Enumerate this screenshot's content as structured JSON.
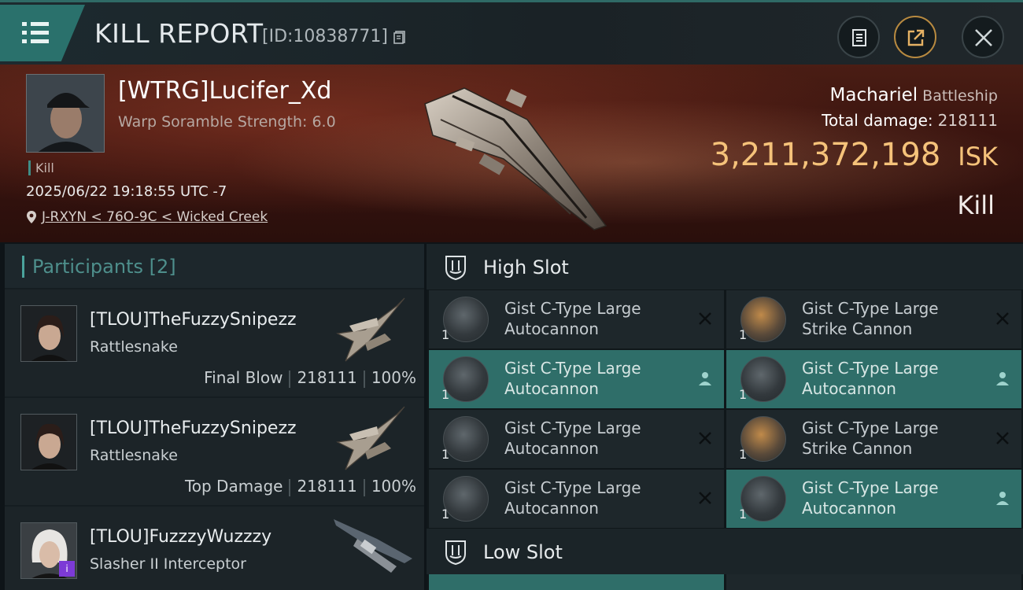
{
  "header": {
    "title": "KILL REPORT",
    "report_id": "[ID:10838771]"
  },
  "victim": {
    "name": "[WTRG]Lucifer_Xd",
    "scramble": "Warp Soramble Strength: 6.0",
    "tag": "Kill",
    "datetime": "2025/06/22 19:18:55 UTC -7",
    "location": "J-RXYN < 76O-9C < Wicked Creek",
    "ship": "Machariel",
    "ship_class": "Battleship",
    "total_damage_label": "Total damage:",
    "total_damage": "218111",
    "isk_value": "3,211,372,198",
    "isk_unit": "ISK",
    "result": "Kill"
  },
  "participants": {
    "label": "Participants",
    "count": "[2]",
    "rows": [
      {
        "name": "[TLOU]TheFuzzySnipezz",
        "ship": "Rattlesnake",
        "role": "Final Blow",
        "damage": "218111",
        "percent": "100%"
      },
      {
        "name": "[TLOU]TheFuzzySnipezz",
        "ship": "Rattlesnake",
        "role": "Top Damage",
        "damage": "218111",
        "percent": "100%"
      },
      {
        "name": "[TLOU]FuzzzyWuzzzy",
        "ship": "Slasher II Interceptor",
        "badge": "i"
      }
    ]
  },
  "slots": {
    "high_label": "High Slot",
    "low_label": "Low Slot",
    "modules": [
      {
        "qty": "1",
        "line1": "Gist C-Type Large",
        "line2": "Autocannon",
        "status": "destroyed"
      },
      {
        "qty": "1",
        "line1": "Gist C-Type Large",
        "line2": "Strike Cannon",
        "status": "destroyed"
      },
      {
        "qty": "1",
        "line1": "Gist C-Type Large",
        "line2": "Autocannon",
        "status": "dropped"
      },
      {
        "qty": "1",
        "line1": "Gist C-Type Large",
        "line2": "Autocannon",
        "status": "dropped"
      },
      {
        "qty": "1",
        "line1": "Gist C-Type Large",
        "line2": "Autocannon",
        "status": "destroyed"
      },
      {
        "qty": "1",
        "line1": "Gist C-Type Large",
        "line2": "Strike Cannon",
        "status": "destroyed"
      },
      {
        "qty": "1",
        "line1": "Gist C-Type Large",
        "line2": "Autocannon",
        "status": "destroyed"
      },
      {
        "qty": "1",
        "line1": "Gist C-Type Large",
        "line2": "Autocannon",
        "status": "dropped"
      }
    ]
  },
  "icons": {
    "menu": "menu-icon",
    "copy": "copy-icon",
    "clipboard": "clipboard-icon",
    "share": "share-icon",
    "close": "close-icon",
    "location": "location-pin-icon",
    "shield": "slot-shield-icon",
    "destroyed": "x-icon",
    "dropped": "person-icon"
  },
  "colors": {
    "accent": "#2f6e69",
    "isk": "#f5c27a",
    "header_accent": "#4aa39c"
  }
}
